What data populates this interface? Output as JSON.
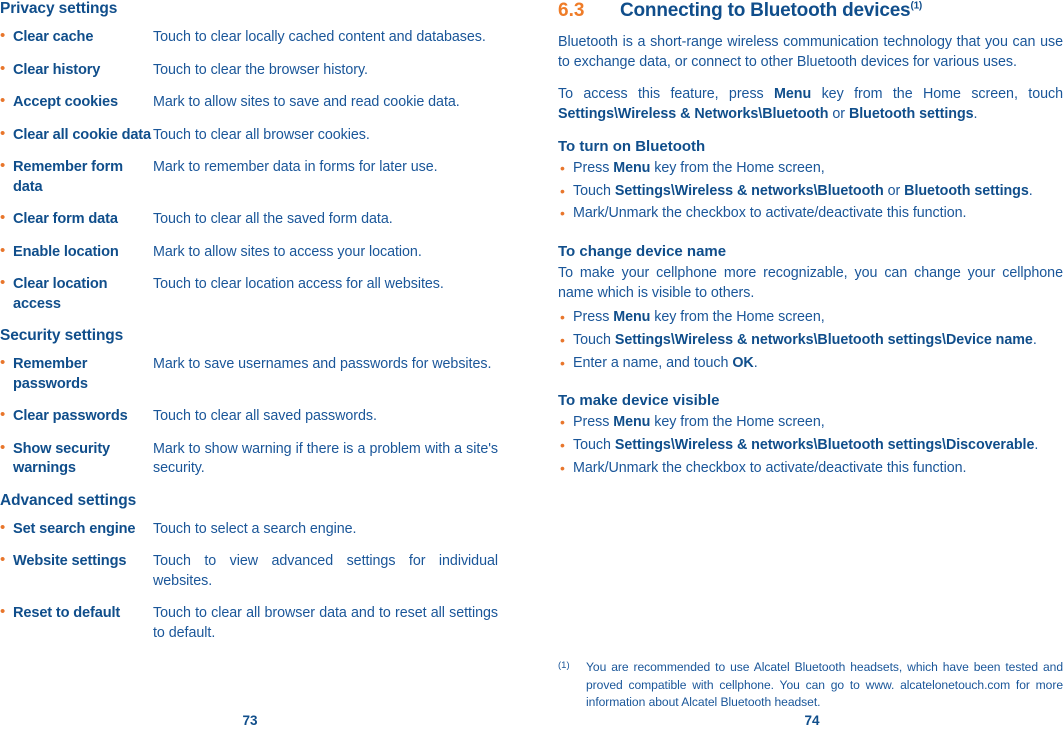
{
  "meta": {
    "colors": {
      "text_blue": "#1a5699",
      "heading_blue": "#104e8b",
      "accent_orange": "#ef7c28",
      "bullet_orange": "#e8762c",
      "background": "#ffffff"
    }
  },
  "left_page": {
    "page_number": "73",
    "sections": [
      {
        "heading": "Privacy settings",
        "rows": [
          {
            "term": "Clear cache",
            "desc": "Touch to clear locally cached content and databases.",
            "justify": true
          },
          {
            "term": "Clear history",
            "desc": "Touch to clear the browser history.",
            "justify": false
          },
          {
            "term": "Accept cookies",
            "desc": "Mark to allow sites to save and read cookie data.",
            "justify": false
          },
          {
            "term": "Clear all cookie data",
            "desc": "Touch to clear all browser cookies.",
            "justify": false
          },
          {
            "term": "Remember form data",
            "desc": "Mark to remember data in forms for later use.",
            "justify": false
          },
          {
            "term": "Clear form data",
            "desc": "Touch to clear all the saved form data.",
            "justify": false
          },
          {
            "term": "Enable location",
            "desc": "Mark to allow sites to access your location.",
            "justify": false
          },
          {
            "term": "Clear location access",
            "desc": "Touch to clear location access for all websites.",
            "justify": false
          }
        ]
      },
      {
        "heading": "Security settings",
        "rows": [
          {
            "term": "Remember passwords",
            "desc": "Mark to save usernames and passwords for websites.",
            "justify": true
          },
          {
            "term": "Clear passwords",
            "desc": "Touch to clear all saved passwords.",
            "justify": false
          },
          {
            "term": "Show security warnings",
            "desc": "Mark to show warning if there is a problem with a site's security.",
            "justify": true
          }
        ]
      },
      {
        "heading": "Advanced settings",
        "rows": [
          {
            "term": "Set search engine",
            "desc": "Touch to select a search engine.",
            "justify": false
          },
          {
            "term": "Website settings",
            "desc": "Touch to view advanced settings for individual websites.",
            "justify": true
          },
          {
            "term": "Reset to default",
            "desc": "Touch to clear all browser data and to reset all settings to default.",
            "justify": true
          }
        ]
      }
    ]
  },
  "right_page": {
    "page_number": "74",
    "section_number": "6.3",
    "section_title": "Connecting to Bluetooth devices",
    "section_title_footnote_marker": "(1)",
    "intro_paragraph": "Bluetooth is a short-range wireless communication technology that you can use to exchange data, or connect to other Bluetooth devices for various uses.",
    "access_paragraph": {
      "part1": "To access this feature, press ",
      "bold1": "Menu",
      "part2": " key from the Home screen, touch ",
      "bold2": "Settings\\Wireless & Networks\\Bluetooth",
      "part3": " or ",
      "bold3": "Bluetooth settings",
      "part4": "."
    },
    "procedures": [
      {
        "heading": "To turn on Bluetooth",
        "steps": [
          {
            "part1": "Press ",
            "bold1": "Menu",
            "part2": " key from the Home screen,",
            "justify": false
          },
          {
            "part1": "Touch ",
            "bold1": "Settings\\Wireless & networks\\Bluetooth",
            "part2": " or ",
            "bold2": "Bluetooth settings",
            "part3": ".",
            "justify": true
          },
          {
            "part1": "Mark/Unmark the checkbox to activate/deactivate this function.",
            "justify": false
          }
        ]
      },
      {
        "heading": "To change device name",
        "intro": "To make your cellphone more recognizable, you can change your cellphone name which is visible to others.",
        "steps": [
          {
            "part1": "Press ",
            "bold1": "Menu",
            "part2": " key from the Home screen,",
            "justify": false
          },
          {
            "part1": "Touch ",
            "bold1": "Settings\\Wireless & networks\\Bluetooth settings\\Device name",
            "part2": ".",
            "justify": false
          },
          {
            "part1": "Enter a name, and touch ",
            "bold1": "OK",
            "part2": ".",
            "justify": false
          }
        ]
      },
      {
        "heading": "To make device visible",
        "steps": [
          {
            "part1": "Press ",
            "bold1": "Menu",
            "part2": " key from the Home screen,",
            "justify": false
          },
          {
            "part1": "Touch ",
            "bold1": "Settings\\Wireless & networks\\Bluetooth settings\\Discoverable",
            "part2": ".",
            "justify": true
          },
          {
            "part1": "Mark/Unmark the checkbox to activate/deactivate this function.",
            "justify": false
          }
        ]
      }
    ],
    "footnote": {
      "marker": "(1)",
      "text": "You are recommended to use Alcatel Bluetooth headsets, which have been tested and proved compatible with cellphone. You can go to www. alcatelonetouch.com for more information about Alcatel Bluetooth headset."
    }
  }
}
